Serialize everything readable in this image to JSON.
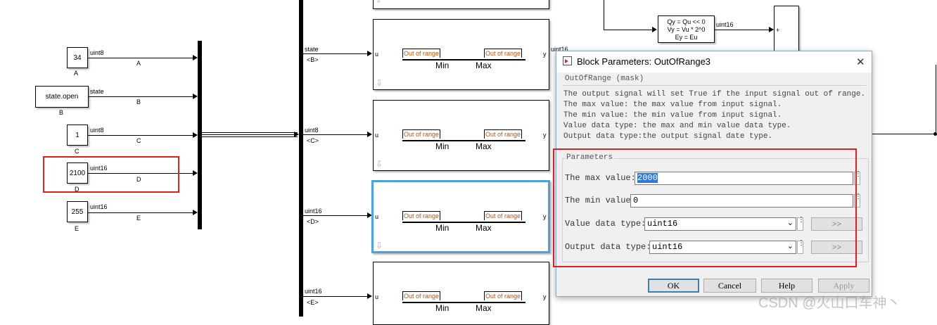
{
  "constants": [
    {
      "value": "34",
      "name": "A",
      "type": "uint8",
      "bus_label": "A"
    },
    {
      "value": "state.open",
      "name": "B",
      "type": "state",
      "bus_label": "B"
    },
    {
      "value": "1",
      "name": "C",
      "type": "uint8",
      "bus_label": "C"
    },
    {
      "value": "2100",
      "name": "D",
      "type": "uint16",
      "bus_label": "D"
    },
    {
      "value": "255",
      "name": "E",
      "type": "uint16",
      "bus_label": "E"
    }
  ],
  "subsystems": [
    {
      "signal": "state",
      "bus_sel": "<B>",
      "in_port": "u",
      "out_port": "y",
      "out_type": "uint16",
      "left_label": "Out of range",
      "right_label": "Out of range",
      "min": "Min",
      "max": "Max"
    },
    {
      "signal": "uint8",
      "bus_sel": "<C>",
      "in_port": "u",
      "out_port": "y",
      "left_label": "Out of range",
      "right_label": "Out of range",
      "min": "Min",
      "max": "Max"
    },
    {
      "signal": "uint16",
      "bus_sel": "<D>",
      "in_port": "u",
      "out_port": "y",
      "left_label": "Out of range",
      "right_label": "Out of range",
      "min": "Min",
      "max": "Max"
    },
    {
      "signal": "uint16",
      "bus_sel": "<E>",
      "in_port": "u",
      "out_port": "y",
      "left_label": "Out of range",
      "right_label": "Out of range",
      "min": "Min",
      "max": "Max"
    }
  ],
  "fcn_block": {
    "line1": "Qy = Qu << 0",
    "line2": "Vy = Vu * 2^0",
    "line3": "Ey = Eu",
    "out_type": "uint16",
    "sum_sign": "+"
  },
  "dialog": {
    "title": "Block Parameters: OutOfRange3",
    "close": "✕",
    "mask_group": "OutOfRange (mask)",
    "description": [
      "The output signal will set True if the input signal out of range.",
      "The max value: the max value from input signal.",
      "The min value: the min value from input signal.",
      "Value data type: the max and min value data type.",
      "Output data type:the output signal date type."
    ],
    "params_group": "Parameters",
    "max_label": "The max value:",
    "max_value": "2000",
    "min_label": "The min value",
    "min_value": "0",
    "value_dtype_label": "Value data type:",
    "value_dtype": "uint16",
    "output_dtype_label": "Output data type:",
    "output_dtype": "uint16",
    "assistant_btn": ">>",
    "ok": "OK",
    "cancel": "Cancel",
    "help": "Help",
    "apply": "Apply"
  },
  "watermark": "CSDN @火山口车神丶",
  "colors": {
    "highlight": "#e02020",
    "selection": "#4aa3df",
    "range_text": "#c05000"
  }
}
